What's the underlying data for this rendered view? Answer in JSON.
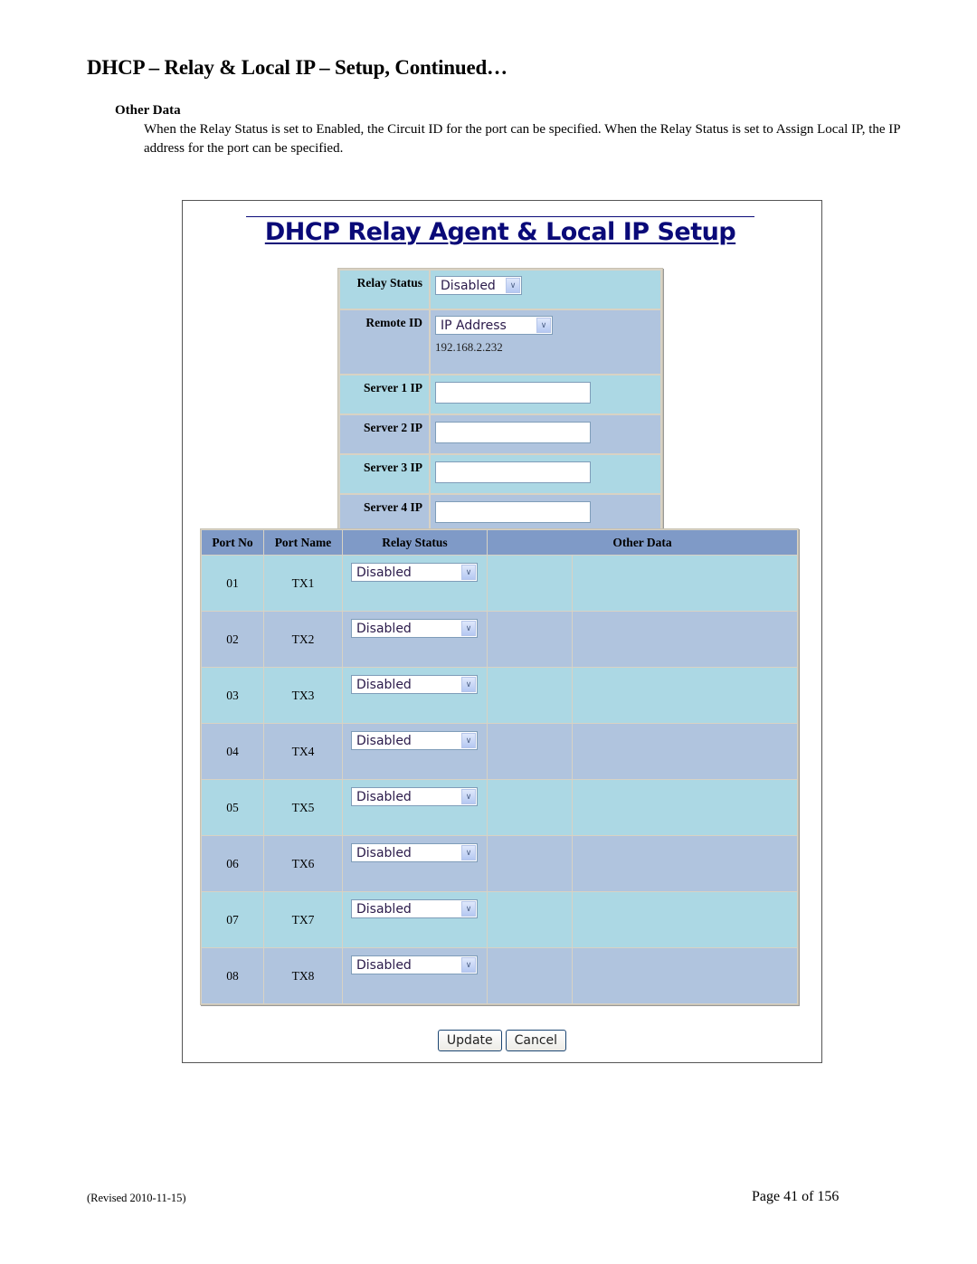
{
  "document": {
    "title": "DHCP – Relay & Local IP – Setup, Continued…",
    "section_heading": "Other Data",
    "section_body": "When the Relay Status is set to Enabled, the Circuit ID for the port can be specified.  When the Relay Status is set to Assign Local IP, the IP address for the port can be specified."
  },
  "app": {
    "title": "DHCP Relay Agent & Local IP Setup",
    "settings": {
      "relay_status": {
        "label": "Relay Status",
        "value": "Disabled"
      },
      "remote_id": {
        "label": "Remote ID",
        "value": "IP Address",
        "ip": "192.168.2.232"
      },
      "servers": [
        {
          "label": "Server 1 IP",
          "value": ""
        },
        {
          "label": "Server 2 IP",
          "value": ""
        },
        {
          "label": "Server 3 IP",
          "value": ""
        },
        {
          "label": "Server 4 IP",
          "value": ""
        }
      ]
    },
    "port_table": {
      "headers": [
        "Port No",
        "Port Name",
        "Relay Status",
        "Other Data"
      ],
      "rows": [
        {
          "port_no": "01",
          "port_name": "TX1",
          "relay_status": "Disabled"
        },
        {
          "port_no": "02",
          "port_name": "TX2",
          "relay_status": "Disabled"
        },
        {
          "port_no": "03",
          "port_name": "TX3",
          "relay_status": "Disabled"
        },
        {
          "port_no": "04",
          "port_name": "TX4",
          "relay_status": "Disabled"
        },
        {
          "port_no": "05",
          "port_name": "TX5",
          "relay_status": "Disabled"
        },
        {
          "port_no": "06",
          "port_name": "TX6",
          "relay_status": "Disabled"
        },
        {
          "port_no": "07",
          "port_name": "TX7",
          "relay_status": "Disabled"
        },
        {
          "port_no": "08",
          "port_name": "TX8",
          "relay_status": "Disabled"
        }
      ]
    },
    "buttons": {
      "update": "Update",
      "cancel": "Cancel"
    },
    "icons": {
      "dropdown": "chevron-down-icon",
      "dropdown_glyph": "﹀"
    },
    "colors": {
      "title": "#0a0a78",
      "row_light": "#acd8e4",
      "row_dark": "#b0c4de",
      "header": "#7f9ac7"
    }
  },
  "footer": {
    "revised": "(Revised 2010-11-15)",
    "page": "Page 41 of 156"
  }
}
